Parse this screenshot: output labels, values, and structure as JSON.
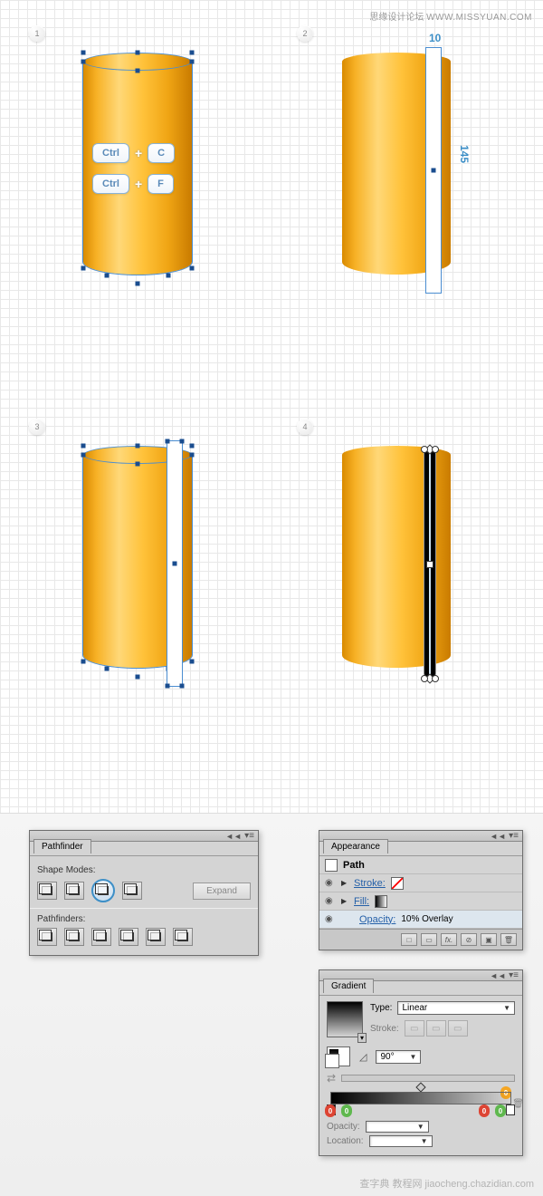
{
  "watermark_top_cn": "思缘设计论坛",
  "watermark_top_url": "WWW.MISSYUAN.COM",
  "watermark_bottom": "查字典 教程网  jiaocheng.chazidian.com",
  "steps": {
    "s1": "1",
    "s2": "2",
    "s3": "3",
    "s4": "4"
  },
  "keys": {
    "ctrl": "Ctrl",
    "c": "C",
    "f": "F",
    "plus": "+"
  },
  "dims": {
    "w": "10",
    "h": "145"
  },
  "pathfinder": {
    "title": "Pathfinder",
    "shape_modes": "Shape Modes:",
    "pathfinders": "Pathfinders:",
    "expand": "Expand"
  },
  "appearance": {
    "title": "Appearance",
    "path": "Path",
    "stroke": "Stroke:",
    "fill": "Fill:",
    "opacity_lbl": "Opacity:",
    "opacity_val": "10% Overlay",
    "fx": "fx."
  },
  "gradient": {
    "title": "Gradient",
    "type_lbl": "Type:",
    "type_val": "Linear",
    "stroke_lbl": "Stroke:",
    "angle": "90°",
    "opacity": "Opacity:",
    "location": "Location:",
    "badge0": "0"
  }
}
